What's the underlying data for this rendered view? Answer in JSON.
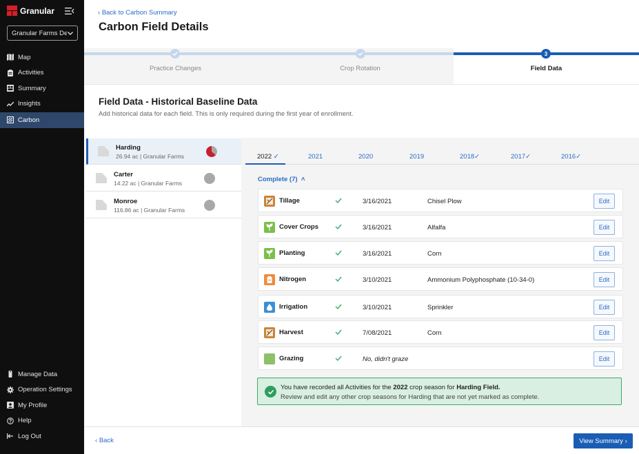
{
  "app": {
    "brand": "Granular",
    "org_select": "Granular Farms De"
  },
  "nav": {
    "items": [
      {
        "label": "Map",
        "icon": "map-icon"
      },
      {
        "label": "Activities",
        "icon": "clipboard-icon"
      },
      {
        "label": "Summary",
        "icon": "summary-icon"
      },
      {
        "label": "Insights",
        "icon": "trend-icon"
      },
      {
        "label": "Carbon",
        "icon": "carbon-icon",
        "active": true
      }
    ],
    "bottom": [
      {
        "label": "Manage Data",
        "icon": "data-icon"
      },
      {
        "label": "Operation Settings",
        "icon": "gear-icon"
      },
      {
        "label": "My Profile",
        "icon": "profile-icon"
      },
      {
        "label": "Help",
        "icon": "help-icon"
      },
      {
        "label": "Log Out",
        "icon": "logout-icon"
      }
    ]
  },
  "header": {
    "back_link": "Back to Carbon Summary",
    "title": "Carbon Field Details"
  },
  "stepper": {
    "steps": [
      {
        "label": "Practice Changes",
        "state": "done"
      },
      {
        "label": "Crop Rotation",
        "state": "done"
      },
      {
        "label": "Field Data",
        "state": "current",
        "number": "3"
      }
    ]
  },
  "section": {
    "title": "Field Data - Historical Baseline Data",
    "subtitle": "Add historical data for each field. This is only required during the first year of enrollment."
  },
  "fields": [
    {
      "name": "Harding",
      "meta": "26.94 ac | Granular Farms",
      "selected": true,
      "status": "partial"
    },
    {
      "name": "Carter",
      "meta": "14.22 ac  | Granular Farms",
      "selected": false,
      "status": "none"
    },
    {
      "name": "Monroe",
      "meta": "116.86 ac  | Granular Farms",
      "selected": false,
      "status": "none"
    }
  ],
  "years": [
    {
      "label": "2022",
      "checked": true,
      "active": true
    },
    {
      "label": "2021",
      "checked": false
    },
    {
      "label": "2020",
      "checked": false
    },
    {
      "label": "2019",
      "checked": false
    },
    {
      "label": "2018",
      "checked": true
    },
    {
      "label": "2017",
      "checked": true
    },
    {
      "label": "2016",
      "checked": true
    }
  ],
  "complete_toggle": "Complete (7)",
  "activities": [
    {
      "name": "Tillage",
      "date": "3/16/2021",
      "detail": "Chisel Plow",
      "icon": "tillage-icon",
      "color": "#c9853a",
      "edit": "Edit"
    },
    {
      "name": "Cover Crops",
      "date": "3/16/2021",
      "detail": "Alfalfa",
      "icon": "sprout-icon",
      "color": "#7bbf4a",
      "edit": "Edit"
    },
    {
      "name": "Planting",
      "date": "3/16/2021",
      "detail": "Corn",
      "icon": "sprout-icon",
      "color": "#7bbf4a",
      "edit": "Edit"
    },
    {
      "name": "Nitrogen",
      "date": "3/10/2021",
      "detail": "Ammonium Polyphosphate (10-34-0)",
      "icon": "bag-icon",
      "color": "#f08c3a",
      "edit": "Edit"
    },
    {
      "name": "Irrigation",
      "date": "3/10/2021",
      "detail": "Sprinkler",
      "icon": "droplet-icon",
      "color": "#3b8fd6",
      "edit": "Edit"
    },
    {
      "name": "Harvest",
      "date": "7/08/2021",
      "detail": "Corn",
      "icon": "harvest-icon",
      "color": "#c9853a",
      "edit": "Edit"
    },
    {
      "name": "Grazing",
      "date": "",
      "detail": "No, didn't graze",
      "icon": "grazing-icon",
      "color": "#8cc06a",
      "edit": "Edit",
      "italic": true
    }
  ],
  "alert": {
    "l1_a": "You have recorded all Activities for the ",
    "l1_year": "2022",
    "l1_b": " crop season for ",
    "l1_field": "Harding Field.",
    "l2": "Review and edit any other crop seasons for Harding that are not yet marked as complete."
  },
  "footer": {
    "back": "Back",
    "view_summary": "View Summary"
  }
}
